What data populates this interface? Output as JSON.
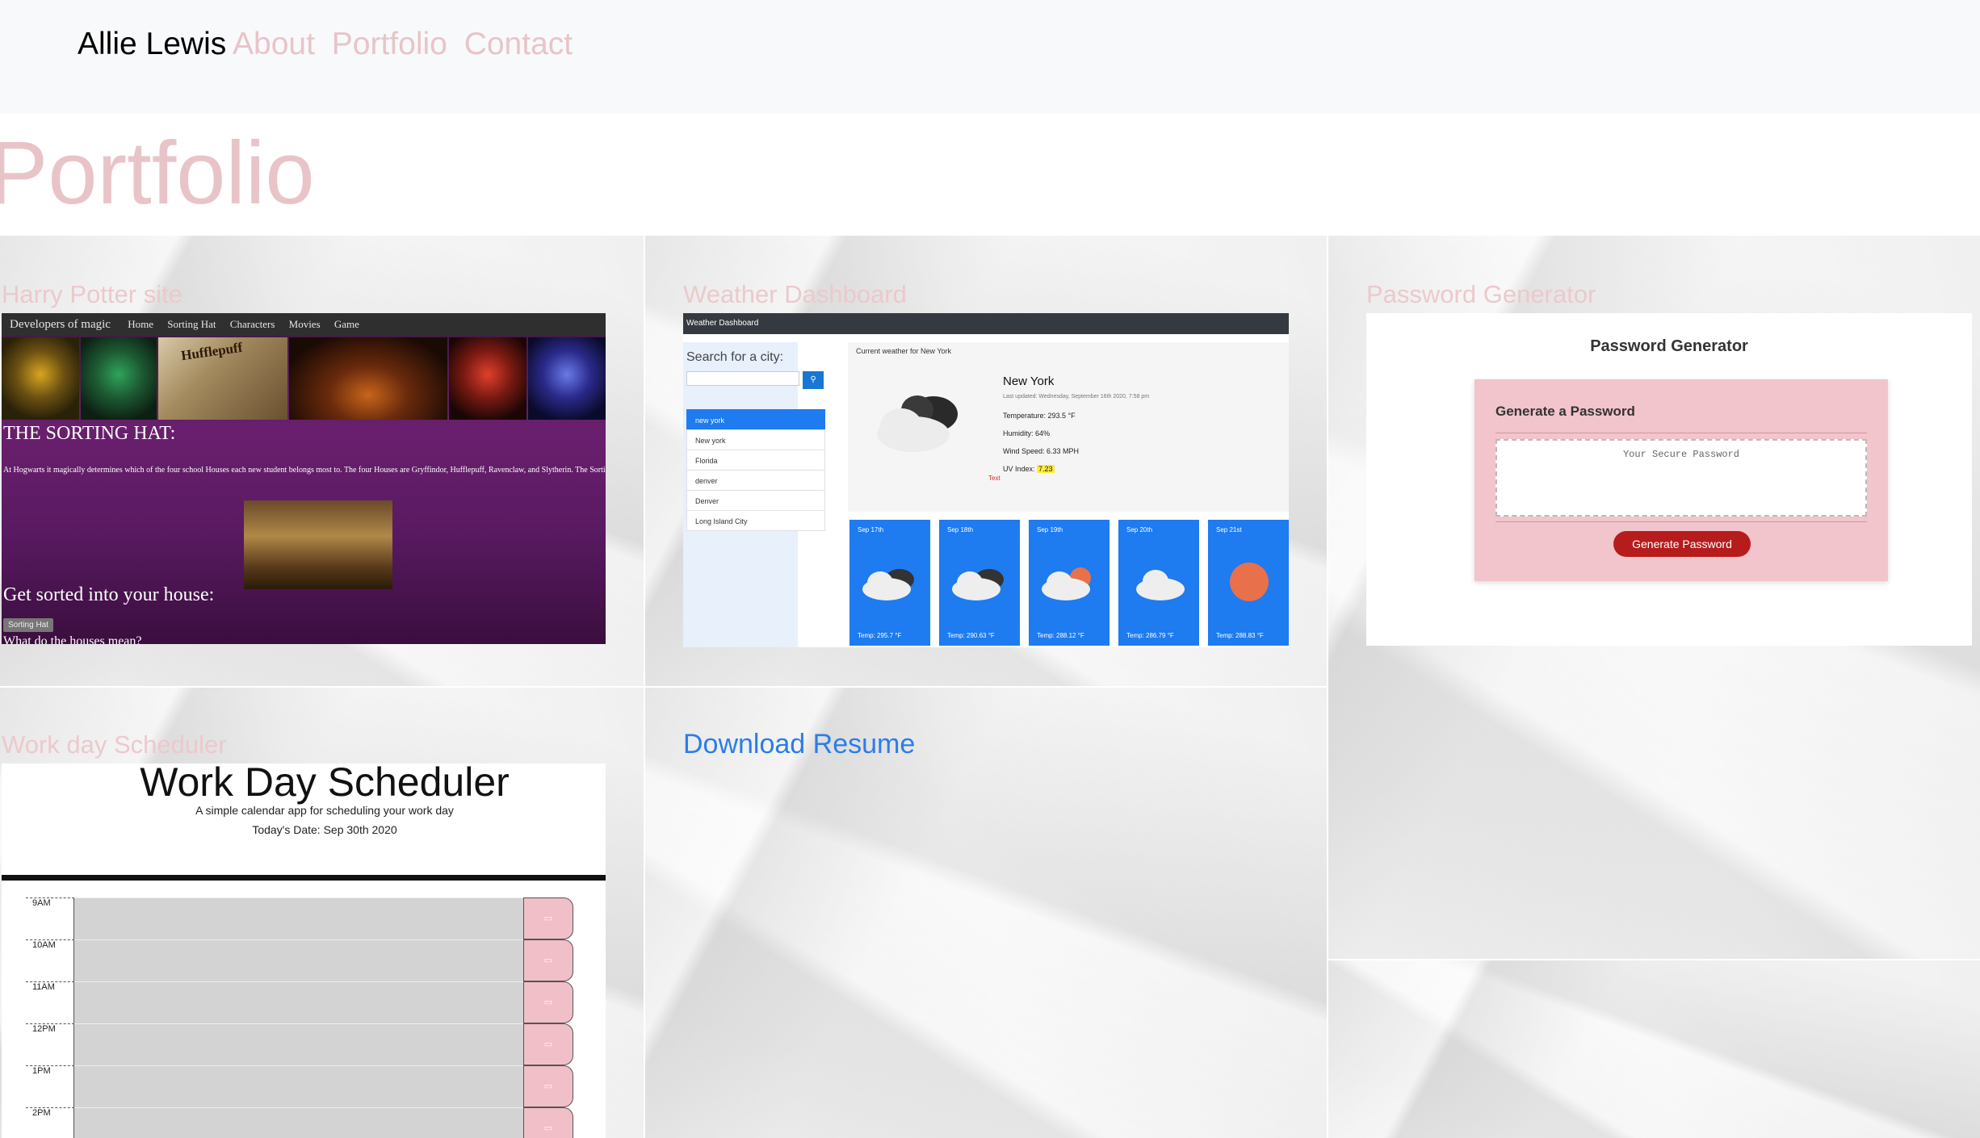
{
  "nav": {
    "brand": "Allie Lewis",
    "links": [
      "About",
      "Portfolio",
      "Contact"
    ]
  },
  "page": {
    "title": "Portfolio"
  },
  "projects": [
    {
      "title": "Harry Potter site",
      "preview": {
        "nav_brand": "Developers of magic",
        "nav_items": [
          "Home",
          "Sorting Hat",
          "Characters",
          "Movies",
          "Game"
        ],
        "crest_banner": "Hufflepuff",
        "heading": "THE SORTING HAT:",
        "paragraph": "At Hogwarts it magically determines which of the four school Houses each new student belongs most to. The four Houses are Gryffindor, Hufflepuff, Ravenclaw, and Slytherin. The Sorting Hat originally belonged to Godric Gryffindor, one of the four founders of Hogwarts. It normally will stay in the Headmaster's office until it is needed",
        "subheading": "Get sorted into your house:",
        "button": "Sorting Hat",
        "footer_text": "What do the houses mean?"
      }
    },
    {
      "title": "Weather Dashboard",
      "preview": {
        "nav_title": "Weather Dashboard",
        "search_label": "Search for a city:",
        "search_button_icon": "search-icon",
        "history": [
          "new york",
          "New york",
          "Florida",
          "denver",
          "Denver",
          "Long Island City"
        ],
        "current_label": "Current weather for New York",
        "city": "New York",
        "updated": "Last updated: Wednesday, September 16th 2020, 7:58 pm",
        "temperature": "Temperature: 293.5 °F",
        "humidity": "Humidity: 64%",
        "wind": "Wind Speed: 6.33 MPH",
        "uv_label": "UV Index:",
        "uv_value": "7.23",
        "icon_caption": "Text",
        "forecast": [
          {
            "date": "Sep 17th",
            "temp": "Temp: 295.7 °F",
            "icon": "cloud-icon"
          },
          {
            "date": "Sep 18th",
            "temp": "Temp: 290.63 °F",
            "icon": "cloud-icon"
          },
          {
            "date": "Sep 19th",
            "temp": "Temp: 288.12 °F",
            "icon": "sun-cloud-icon"
          },
          {
            "date": "Sep 20th",
            "temp": "Temp: 286.79 °F",
            "icon": "cloud-icon"
          },
          {
            "date": "Sep 21st",
            "temp": "Temp: 288.83 °F",
            "icon": "sun-icon"
          }
        ]
      }
    },
    {
      "title": "Password Generator",
      "preview": {
        "title": "Password Generator",
        "card_title": "Generate a Password",
        "placeholder": "Your Secure Password",
        "button": "Generate Password"
      }
    },
    {
      "title": "Work day Scheduler",
      "preview": {
        "title": "Work Day Scheduler",
        "subtitle": "A simple calendar app for scheduling your work day",
        "date": "Today's Date: Sep 30th 2020",
        "hours": [
          "9AM",
          "10AM",
          "11AM",
          "12PM",
          "1PM",
          "2PM"
        ],
        "save_icon": "save-icon"
      }
    }
  ],
  "resume": {
    "label": "Download Resume"
  },
  "colors": {
    "accent_pink": "#e8c4c8",
    "link_blue": "#2b7de9",
    "navbar_bg": "#f8f9fa"
  }
}
